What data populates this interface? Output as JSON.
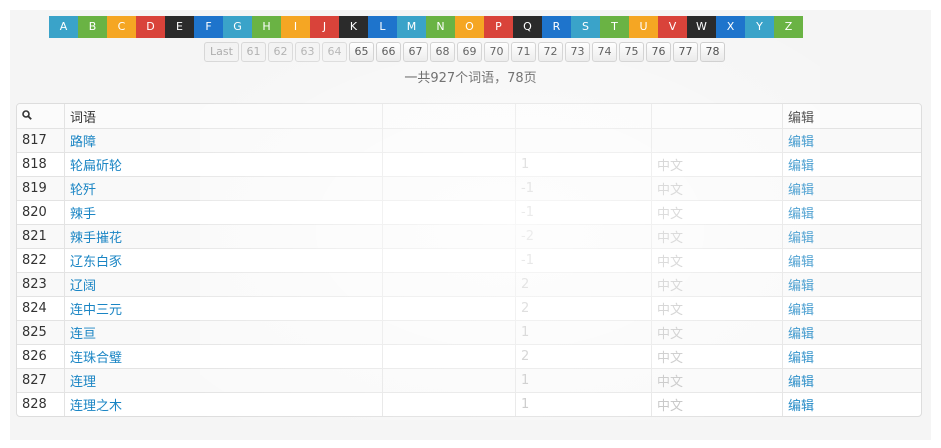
{
  "alphabet": [
    {
      "letter": "A",
      "color": "#3aa3c9"
    },
    {
      "letter": "B",
      "color": "#6ab344"
    },
    {
      "letter": "C",
      "color": "#f5a623"
    },
    {
      "letter": "D",
      "color": "#d9433a"
    },
    {
      "letter": "E",
      "color": "#2b2b2b"
    },
    {
      "letter": "F",
      "color": "#1e74cc"
    },
    {
      "letter": "G",
      "color": "#3aa3c9"
    },
    {
      "letter": "H",
      "color": "#6ab344"
    },
    {
      "letter": "I",
      "color": "#f5a623"
    },
    {
      "letter": "J",
      "color": "#d9433a"
    },
    {
      "letter": "K",
      "color": "#2b2b2b"
    },
    {
      "letter": "L",
      "color": "#1e74cc"
    },
    {
      "letter": "M",
      "color": "#3aa3c9"
    },
    {
      "letter": "N",
      "color": "#6ab344"
    },
    {
      "letter": "O",
      "color": "#f5a623"
    },
    {
      "letter": "P",
      "color": "#d9433a"
    },
    {
      "letter": "Q",
      "color": "#2b2b2b"
    },
    {
      "letter": "R",
      "color": "#1e74cc"
    },
    {
      "letter": "S",
      "color": "#3aa3c9"
    },
    {
      "letter": "T",
      "color": "#6ab344"
    },
    {
      "letter": "U",
      "color": "#f5a623"
    },
    {
      "letter": "V",
      "color": "#d9433a"
    },
    {
      "letter": "W",
      "color": "#2b2b2b"
    },
    {
      "letter": "X",
      "color": "#1e74cc"
    },
    {
      "letter": "Y",
      "color": "#3aa3c9"
    },
    {
      "letter": "Z",
      "color": "#6ab344"
    }
  ],
  "pagination": {
    "last_label": "Last",
    "pages": [
      {
        "label": "61",
        "disabled": true
      },
      {
        "label": "62",
        "disabled": true
      },
      {
        "label": "63",
        "disabled": true
      },
      {
        "label": "64",
        "disabled": true
      },
      {
        "label": "65",
        "disabled": false
      },
      {
        "label": "66",
        "disabled": false
      },
      {
        "label": "67",
        "disabled": false
      },
      {
        "label": "68",
        "disabled": false
      },
      {
        "label": "69",
        "disabled": false
      },
      {
        "label": "70",
        "disabled": false
      },
      {
        "label": "71",
        "disabled": false
      },
      {
        "label": "72",
        "disabled": false
      },
      {
        "label": "73",
        "disabled": false
      },
      {
        "label": "74",
        "disabled": false
      },
      {
        "label": "75",
        "disabled": false
      },
      {
        "label": "76",
        "disabled": false
      },
      {
        "label": "77",
        "disabled": false
      },
      {
        "label": "78",
        "disabled": false
      }
    ]
  },
  "summary": "一共927个词语，78页",
  "table": {
    "search_icon": "search-icon",
    "headers": {
      "id": "",
      "word": "词语",
      "col_a": "",
      "col_b": "",
      "col_c": "",
      "edit": "编辑"
    },
    "rows": [
      {
        "id": "817",
        "word": "路障",
        "a": "",
        "b": "",
        "c": "",
        "edit": "编辑"
      },
      {
        "id": "818",
        "word": "轮扁斫轮",
        "a": "",
        "b": "1",
        "c": "中文",
        "edit": "编辑"
      },
      {
        "id": "819",
        "word": "轮歼",
        "a": "",
        "b": "-1",
        "c": "中文",
        "edit": "编辑"
      },
      {
        "id": "820",
        "word": "辣手",
        "a": "",
        "b": "-1",
        "c": "中文",
        "edit": "编辑"
      },
      {
        "id": "821",
        "word": "辣手摧花",
        "a": "",
        "b": "-2",
        "c": "中文",
        "edit": "编辑"
      },
      {
        "id": "822",
        "word": "辽东白豕",
        "a": "",
        "b": "-1",
        "c": "中文",
        "edit": "编辑"
      },
      {
        "id": "823",
        "word": "辽阔",
        "a": "",
        "b": "2",
        "c": "中文",
        "edit": "编辑"
      },
      {
        "id": "824",
        "word": "连中三元",
        "a": "",
        "b": "2",
        "c": "中文",
        "edit": "编辑"
      },
      {
        "id": "825",
        "word": "连亘",
        "a": "",
        "b": "1",
        "c": "中文",
        "edit": "编辑"
      },
      {
        "id": "826",
        "word": "连珠合璧",
        "a": "",
        "b": "2",
        "c": "中文",
        "edit": "编辑"
      },
      {
        "id": "827",
        "word": "连理",
        "a": "",
        "b": "1",
        "c": "中文",
        "edit": "编辑"
      },
      {
        "id": "828",
        "word": "连理之木",
        "a": "",
        "b": "1",
        "c": "中文",
        "edit": "编辑"
      }
    ]
  }
}
